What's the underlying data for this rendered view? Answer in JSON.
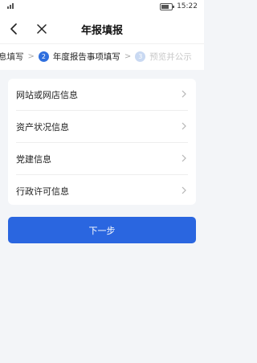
{
  "statusbar": {
    "time": "15:22"
  },
  "navbar": {
    "title": "年报填报",
    "back_icon": "chevron-left-icon",
    "close_icon": "close-icon"
  },
  "steps": [
    {
      "label": "息填写",
      "state": "done"
    },
    {
      "number": "2",
      "label": "年度报告事项填写",
      "state": "active"
    },
    {
      "number": "3",
      "label": "预览并公示",
      "state": "todo"
    }
  ],
  "items": [
    {
      "label": "网站或网店信息"
    },
    {
      "label": "资产状况信息"
    },
    {
      "label": "党建信息"
    },
    {
      "label": "行政许可信息"
    }
  ],
  "next_button": {
    "label": "下一步"
  },
  "colors": {
    "primary": "#2a66e0",
    "step_active": "#2f6fde",
    "step_todo": "#c9d9f2",
    "background": "#f3f5f8"
  }
}
